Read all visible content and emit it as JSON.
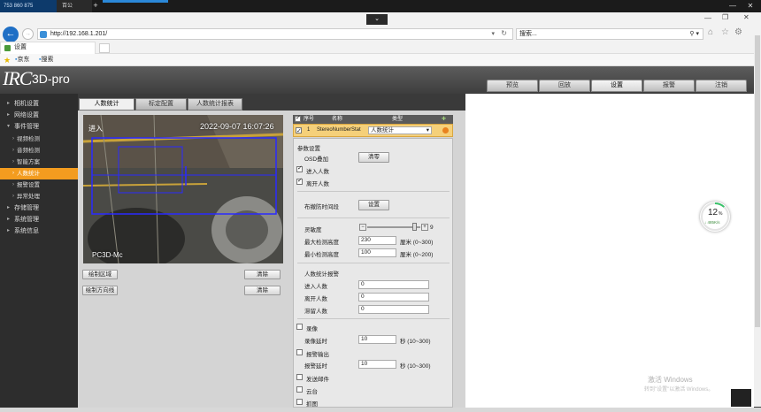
{
  "os_bar": {
    "tab_a": "753 860 875",
    "tab_b": "百公",
    "new_tab": "+",
    "minimize": "—",
    "restore": "❐",
    "close": "✕"
  },
  "browser": {
    "url": "http://192.168.1.201/",
    "search_placeholder": "搜索...",
    "tab_title": "设置",
    "favorites": [
      "京东",
      "搜索"
    ]
  },
  "app": {
    "logo": "IRC",
    "logo_suffix": "3D-pro",
    "nav": [
      "预览",
      "回放",
      "设置",
      "报警",
      "注销"
    ],
    "nav_active": "设置"
  },
  "sidebar": {
    "items": [
      {
        "label": "相机设置",
        "level": 1
      },
      {
        "label": "网络设置",
        "level": 1
      },
      {
        "label": "事件管理",
        "level": 1
      },
      {
        "label": "视频检测",
        "level": 2
      },
      {
        "label": "音频检测",
        "level": 2
      },
      {
        "label": "智能方案",
        "level": 2
      },
      {
        "label": "人数统计",
        "level": 2,
        "active": true
      },
      {
        "label": "报警设置",
        "level": 2
      },
      {
        "label": "异常处理",
        "level": 2
      },
      {
        "label": "存储管理",
        "level": 1
      },
      {
        "label": "系统管理",
        "level": 1
      },
      {
        "label": "系统信息",
        "level": 1
      }
    ]
  },
  "subtabs": [
    "人数统计",
    "标定配置",
    "人数统计报表"
  ],
  "video": {
    "timestamp": "2022-09-07 16:07:26",
    "corner_label": "进入",
    "camera_name": "PC3D-Mc"
  },
  "video_buttons": {
    "draw_area": "绘制区域",
    "draw_direction": "绘制方向线",
    "clear1": "清除",
    "clear2": "清除"
  },
  "rule_list": {
    "headers": [
      "序号",
      "名称",
      "类型"
    ],
    "row": {
      "index": "1",
      "name": "StereoNumberStat",
      "type": "人数统计"
    }
  },
  "params": {
    "section_title": "参数设置",
    "osd_label": "OSD叠加",
    "osd_button": "清零",
    "enter_count_label": "进入人数",
    "leave_count_label": "离开人数",
    "schedule_label": "布撤防时间段",
    "schedule_button": "设置",
    "sensitivity_label": "灵敏度",
    "sensitivity_value": "9",
    "sensitivity_level": 9,
    "sensitivity_max": 10,
    "max_height_label": "最大检测高度",
    "max_height_value": "230",
    "max_height_unit": "厘米 (0~300)",
    "min_height_label": "最小检测高度",
    "min_height_value": "100",
    "min_height_unit": "厘米 (0~200)",
    "alarm_title": "人数统计报警",
    "enter_num_label": "进入人数",
    "enter_num_value": "0",
    "leave_num_label": "离开人数",
    "leave_num_value": "0",
    "stay_num_label": "滞留人数",
    "stay_num_value": "0",
    "record_label": "录像",
    "record_delay_label": "录像延时",
    "record_delay_value": "10",
    "record_delay_unit": "秒 (10~300)",
    "alarm_out_label": "报警输出",
    "alarm_delay_label": "报警延时",
    "alarm_delay_value": "10",
    "alarm_delay_unit": "秒 (10~300)",
    "email_label": "发送邮件",
    "ptz_label": "云台",
    "snapshot_label": "抓图"
  },
  "gauge": {
    "percent": "12",
    "percent_sign": "%",
    "speed": "↓ 485K/s"
  },
  "watermark": {
    "line1": "激活 Windows",
    "line2": "转到\"设置\"以激活 Windows。"
  }
}
